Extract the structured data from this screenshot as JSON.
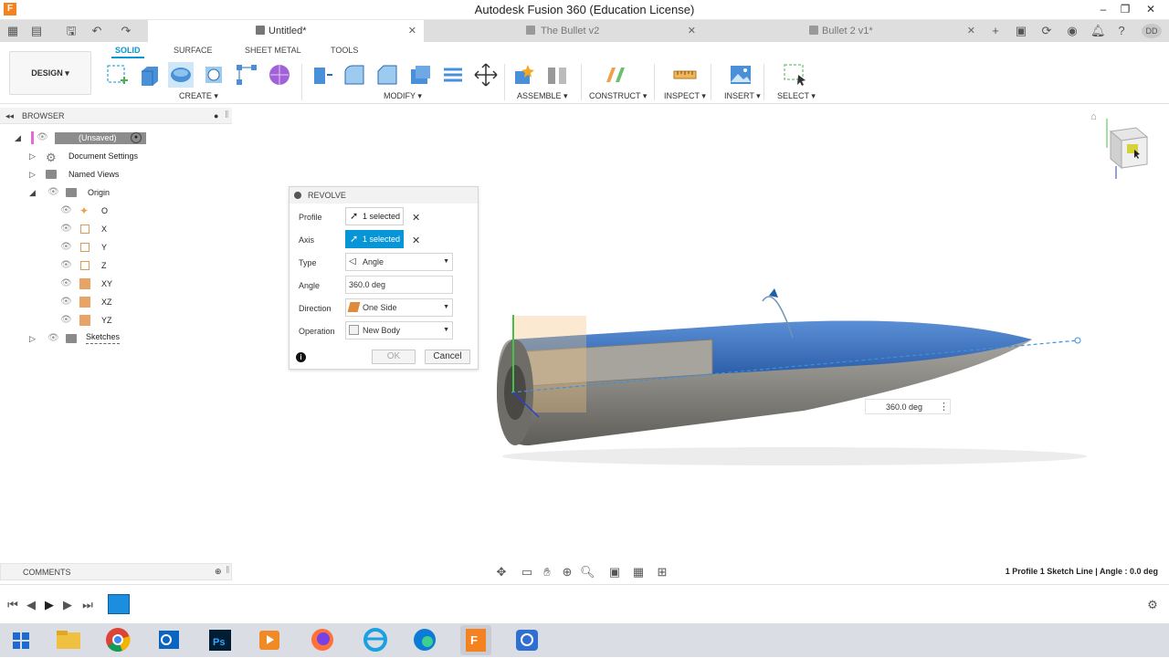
{
  "window": {
    "title": "Autodesk Fusion 360 (Education License)",
    "logo_letter": "F"
  },
  "tabs": [
    {
      "label": "Untitled*",
      "active": true
    },
    {
      "label": "The Bullet v2",
      "active": false
    },
    {
      "label": "Bullet 2 v1*",
      "active": false
    }
  ],
  "user": {
    "initials": "DD"
  },
  "workspace_tabs": [
    "SOLID",
    "SURFACE",
    "SHEET METAL",
    "TOOLS"
  ],
  "design_button": "DESIGN ▾",
  "toolbar_groups": [
    "CREATE ▾",
    "MODIFY ▾",
    "ASSEMBLE ▾",
    "CONSTRUCT ▾",
    "INSPECT ▾",
    "INSERT ▾",
    "SELECT ▾"
  ],
  "browser": {
    "header": "BROWSER",
    "root": "(Unsaved)",
    "items": [
      "Document Settings",
      "Named Views",
      "Origin",
      "O",
      "X",
      "Y",
      "Z",
      "XY",
      "XZ",
      "YZ",
      "Sketches"
    ]
  },
  "revolve": {
    "title": "REVOLVE",
    "labels": {
      "profile": "Profile",
      "axis": "Axis",
      "type": "Type",
      "angle": "Angle",
      "direction": "Direction",
      "operation": "Operation"
    },
    "profile_value": "1 selected",
    "axis_value": "1 selected",
    "type_value": "Angle",
    "angle_value": "360.0 deg",
    "direction_value": "One Side",
    "operation_value": "New Body",
    "ok": "OK",
    "cancel": "Cancel"
  },
  "canvas": {
    "angle_box": "360.0 deg"
  },
  "comments": {
    "label": "COMMENTS"
  },
  "status": {
    "message": "1 Profile 1 Sketch Line | Angle : 0.0 deg"
  },
  "colors": {
    "accent": "#0696d7",
    "body_blue": "#3d74c0",
    "body_gray": "#8a8883",
    "profile_orange": "#f0b45a"
  }
}
